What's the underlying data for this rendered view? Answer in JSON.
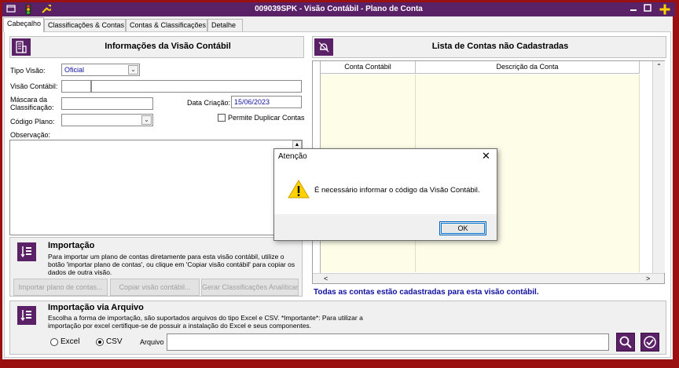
{
  "window": {
    "title": "009039SPK - Visão Contábil - Plano de Conta",
    "colors": {
      "title_bg": "#5b2167",
      "frame": "#9a1010",
      "accent_blue": "#1010a0",
      "yellow": "#ffd200"
    }
  },
  "tabs": [
    {
      "label": "Cabeçalho",
      "active": true
    },
    {
      "label": "Classificações & Contas"
    },
    {
      "label": "Contas & Classificações"
    },
    {
      "label": "Detalhe"
    }
  ],
  "info_panel": {
    "title": "Informações da Visão Contábil",
    "tipo_visao_label": "Tipo Visão:",
    "tipo_visao_value": "Oficial",
    "visao_contabil_label": "Visão Contábil:",
    "mascara_label_line1": "Máscara da",
    "mascara_label_line2": "Classificação:",
    "data_criacao_label": "Data Criação:",
    "data_criacao_value": "15/06/2023",
    "codigo_plano_label": "Código Plano:",
    "permite_duplicar_label": "Permite Duplicar Contas",
    "observacao_label": "Observação:"
  },
  "importacao": {
    "title": "Importação",
    "description": "Para importar um plano de contas diretamente para esta visão contábil, utilize o botão 'importar plano de contas', ou clique em 'Copiar visão contábil' para copiar os dados de outra visão.",
    "btn_importar": "Importar plano de contas...",
    "btn_copiar": "Copiar visão contábil...",
    "btn_gerar": "Gerar Classificações Analíticas"
  },
  "importacao_arquivo": {
    "title": "Importação via Arquivo",
    "description": "Escolha a forma de importação, são suportados arquivos do tipo Excel e CSV. *Importante*: Para utilizar a importação por excel certifique-se de possuir a instalação do Excel e seus componentes.",
    "radio_excel": "Excel",
    "radio_csv": "CSV",
    "selected": "CSV",
    "arquivo_label": "Arquivo"
  },
  "contas_panel": {
    "title": "Lista de Contas não Cadastradas",
    "columns": [
      "Conta Contábil",
      "Descrição da Conta"
    ],
    "status": "Todas as contas estão cadastradas para esta visão contábil."
  },
  "dialog": {
    "title": "Atenção",
    "message": "É necessário informar o código da Visão Contábil.",
    "ok_label": "OK"
  }
}
